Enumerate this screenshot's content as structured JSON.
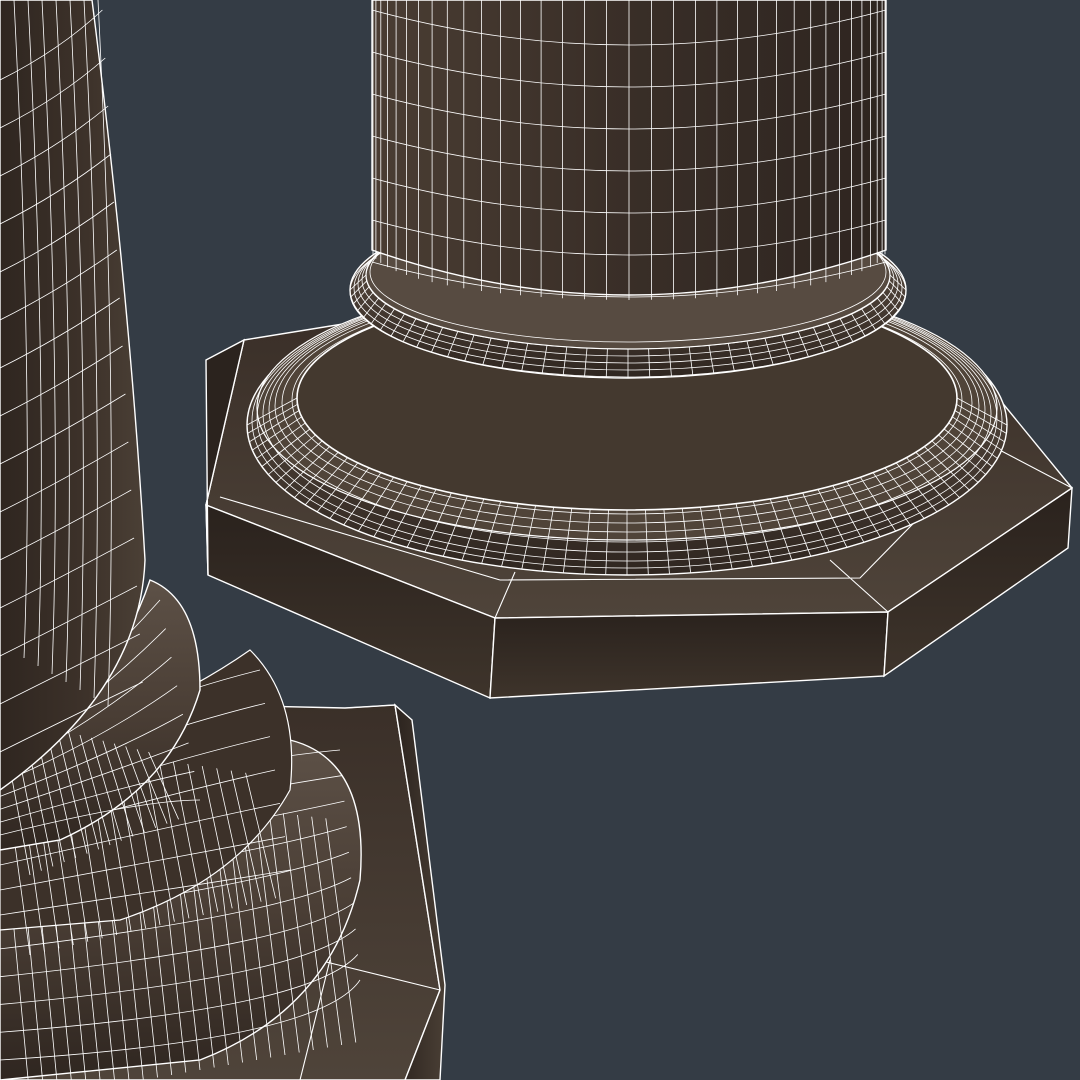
{
  "scene": {
    "kind": "3d-viewport-wireframe-render",
    "background_color": "#343c45",
    "shading": "solid-with-wireframe-overlay",
    "wire_color": "#ffffff",
    "objects": [
      {
        "name": "column-base-right",
        "parts": [
          "column-shaft",
          "upper-torus",
          "lower-torus",
          "octagonal-plinth"
        ],
        "surface_color": "#3d322a"
      },
      {
        "name": "column-base-left",
        "parts": [
          "column-shaft",
          "upper-torus",
          "scotia",
          "lower-torus",
          "octagonal-plinth"
        ],
        "surface_color": "#3d322a"
      }
    ]
  }
}
